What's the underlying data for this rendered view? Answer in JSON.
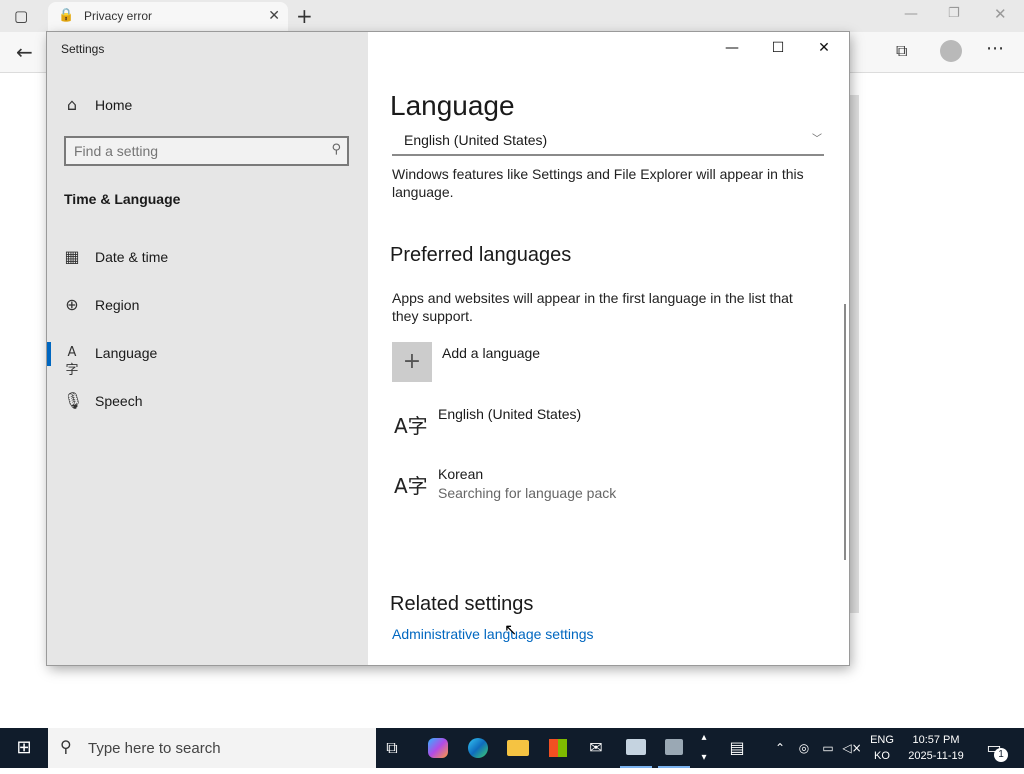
{
  "browser": {
    "tab_title": "Privacy error"
  },
  "settings": {
    "window_title": "Settings",
    "sidebar": {
      "home": "Home",
      "search_placeholder": "Find a setting",
      "section": "Time & Language",
      "items": [
        {
          "label": "Date & time",
          "icon": "calendar-clock-icon"
        },
        {
          "label": "Region",
          "icon": "globe-icon"
        },
        {
          "label": "Language",
          "icon": "language-icon",
          "active": true
        },
        {
          "label": "Speech",
          "icon": "microphone-icon"
        }
      ]
    },
    "main": {
      "title": "Language",
      "display_language_value": "English (United States)",
      "display_language_desc": "Windows features like Settings and File Explorer will appear in this language.",
      "preferred_heading": "Preferred languages",
      "preferred_desc": "Apps and websites will appear in the first language in the list that they support.",
      "add_language": "Add a language",
      "languages": [
        {
          "name": "English (United States)",
          "status": ""
        },
        {
          "name": "Korean",
          "status": "Searching for language pack"
        }
      ],
      "related_heading": "Related settings",
      "admin_link": "Administrative language settings"
    }
  },
  "taskbar": {
    "search_placeholder": "Type here to search",
    "lang_top": "ENG",
    "lang_bottom": "KO",
    "time": "10:57 PM",
    "date": "2025-11-19",
    "notification_count": "1"
  },
  "colors": {
    "accent": "#0067c0",
    "link": "#0067c0",
    "taskbar_bg": "#101c2b",
    "sidebar_bg": "#e6e6e6"
  }
}
